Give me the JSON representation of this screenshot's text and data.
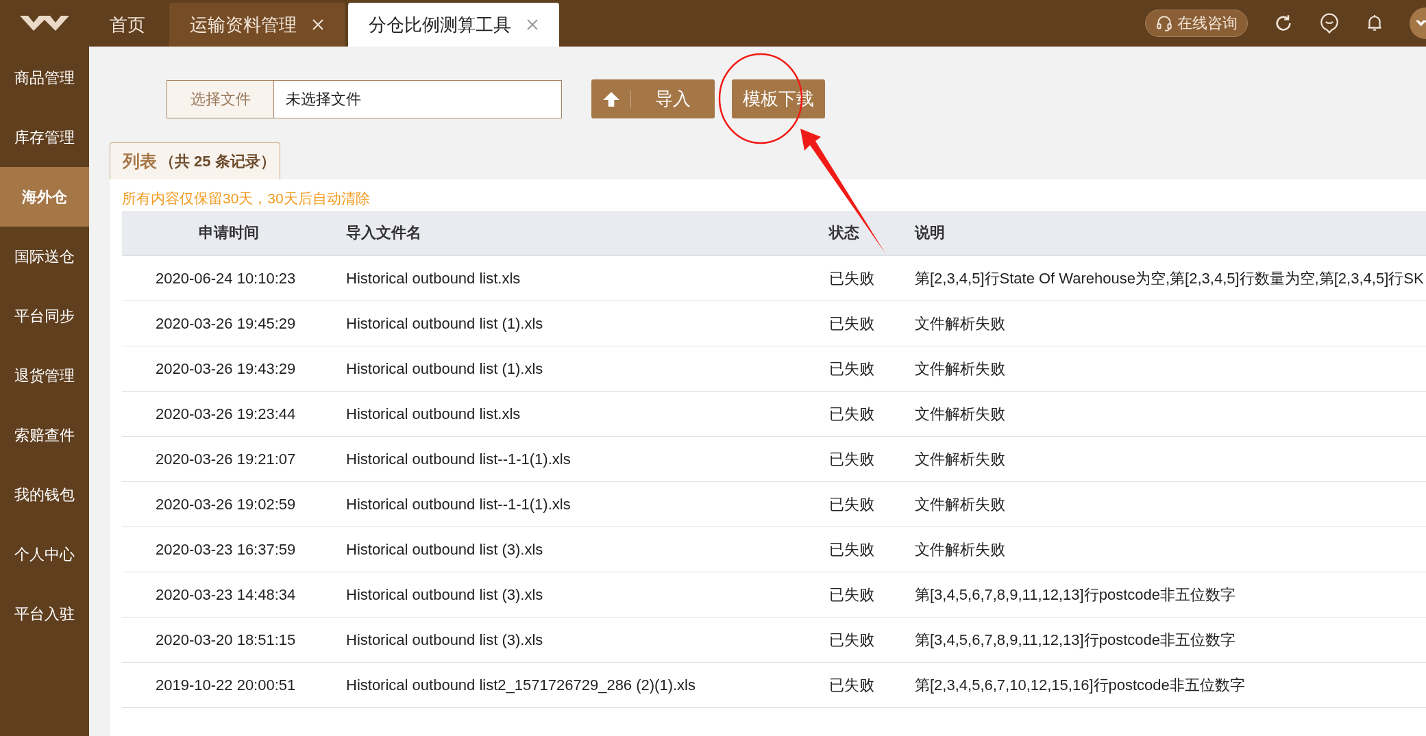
{
  "header": {
    "tabs": [
      {
        "label": "首页",
        "selected": false,
        "closable": false
      },
      {
        "label": "运输资料管理",
        "selected": false,
        "closable": true
      },
      {
        "label": "分仓比例测算工具",
        "selected": true,
        "closable": true
      }
    ],
    "consult_button": "在线咨询"
  },
  "sidebar": {
    "items": [
      {
        "label": "商品管理",
        "selected": false
      },
      {
        "label": "库存管理",
        "selected": false
      },
      {
        "label": "海外仓",
        "selected": true
      },
      {
        "label": "国际送仓",
        "selected": false
      },
      {
        "label": "平台同步",
        "selected": false
      },
      {
        "label": "退货管理",
        "selected": false
      },
      {
        "label": "索赔查件",
        "selected": false
      },
      {
        "label": "我的钱包",
        "selected": false
      },
      {
        "label": "个人中心",
        "selected": false
      },
      {
        "label": "平台入驻",
        "selected": false
      }
    ]
  },
  "upload": {
    "choose_label": "选择文件",
    "file_value": "未选择文件",
    "import_button": "导入",
    "template_button": "模板下载"
  },
  "list": {
    "tab_title": "列表",
    "tab_count": "（共 25 条记录）",
    "notice": "所有内容仅保留30天，30天后自动清除",
    "columns": [
      "申请时间",
      "导入文件名",
      "状态",
      "说明"
    ],
    "rows": [
      {
        "time": "2020-06-24 10:10:23",
        "file": "Historical outbound list.xls",
        "status": "已失败",
        "note": "第[2,3,4,5]行State Of Warehouse为空,第[2,3,4,5]行数量为空,第[2,3,4,5]行SK"
      },
      {
        "time": "2020-03-26 19:45:29",
        "file": "Historical outbound list (1).xls",
        "status": "已失败",
        "note": "文件解析失败"
      },
      {
        "time": "2020-03-26 19:43:29",
        "file": "Historical outbound list (1).xls",
        "status": "已失败",
        "note": "文件解析失败"
      },
      {
        "time": "2020-03-26 19:23:44",
        "file": "Historical outbound list.xls",
        "status": "已失败",
        "note": "文件解析失败"
      },
      {
        "time": "2020-03-26 19:21:07",
        "file": "Historical outbound list--1-1(1).xls",
        "status": "已失败",
        "note": "文件解析失败"
      },
      {
        "time": "2020-03-26 19:02:59",
        "file": "Historical outbound list--1-1(1).xls",
        "status": "已失败",
        "note": "文件解析失败"
      },
      {
        "time": "2020-03-23 16:37:59",
        "file": "Historical outbound list (3).xls",
        "status": "已失败",
        "note": "文件解析失败"
      },
      {
        "time": "2020-03-23 14:48:34",
        "file": "Historical outbound list (3).xls",
        "status": "已失败",
        "note": "第[3,4,5,6,7,8,9,11,12,13]行postcode非五位数字"
      },
      {
        "time": "2020-03-20 18:51:15",
        "file": "Historical outbound list (3).xls",
        "status": "已失败",
        "note": "第[3,4,5,6,7,8,9,11,12,13]行postcode非五位数字"
      },
      {
        "time": "2019-10-22 20:00:51",
        "file": "Historical outbound list2_1571726729_286 (2)(1).xls",
        "status": "已失败",
        "note": "第[2,3,4,5,6,7,10,12,15,16]行postcode非五位数字"
      }
    ]
  }
}
